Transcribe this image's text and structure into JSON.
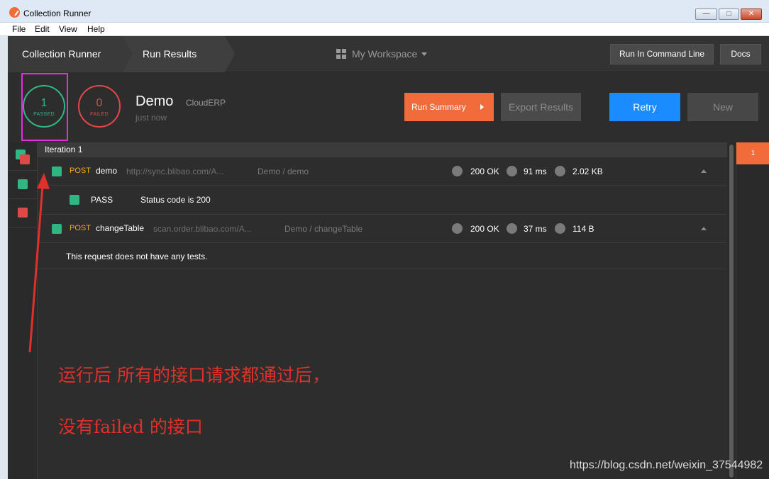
{
  "window": {
    "title": "Collection Runner",
    "minimize": "—",
    "maximize": "□",
    "close": "✕"
  },
  "menu": [
    "File",
    "Edit",
    "View",
    "Help"
  ],
  "nav": {
    "crumb_runner": "Collection Runner",
    "crumb_results": "Run Results",
    "workspace": "My Workspace",
    "run_cli": "Run In Command Line",
    "docs": "Docs"
  },
  "summary": {
    "passed_count": "1",
    "passed_label": "PASSED",
    "failed_count": "0",
    "failed_label": "FAILED",
    "collection_name": "Demo",
    "environment": "CloudERP",
    "time": "just now",
    "run_summary": "Run Summary",
    "export_results": "Export Results",
    "retry": "Retry",
    "new": "New"
  },
  "iteration": {
    "header": "Iteration 1",
    "badge": "1",
    "requests": [
      {
        "method": "POST",
        "name": "demo",
        "url": "http://sync.blibao.com/A...",
        "path": "Demo / demo",
        "status": "200 OK",
        "time": "91 ms",
        "size": "2.02 KB",
        "tests": [
          {
            "status": "PASS",
            "name": "Status code is 200"
          }
        ]
      },
      {
        "method": "POST",
        "name": "changeTable",
        "url": "scan.order.blibao.com/A...",
        "path": "Demo / changeTable",
        "status": "200 OK",
        "time": "37 ms",
        "size": "114 B",
        "no_tests": "This request does not have any tests."
      }
    ]
  },
  "annotation": {
    "line1": "运行后 所有的接口请求都通过后，",
    "line2": "没有failed 的接口"
  },
  "watermark": "https://blog.csdn.net/weixin_37544982",
  "colors": {
    "passed": "#2fb783",
    "failed": "#e04848",
    "accent_orange": "#f26b3a",
    "retry_blue": "#1a8cff",
    "annotation_red": "#e0302a",
    "highlight_magenta": "#e22ee2"
  }
}
